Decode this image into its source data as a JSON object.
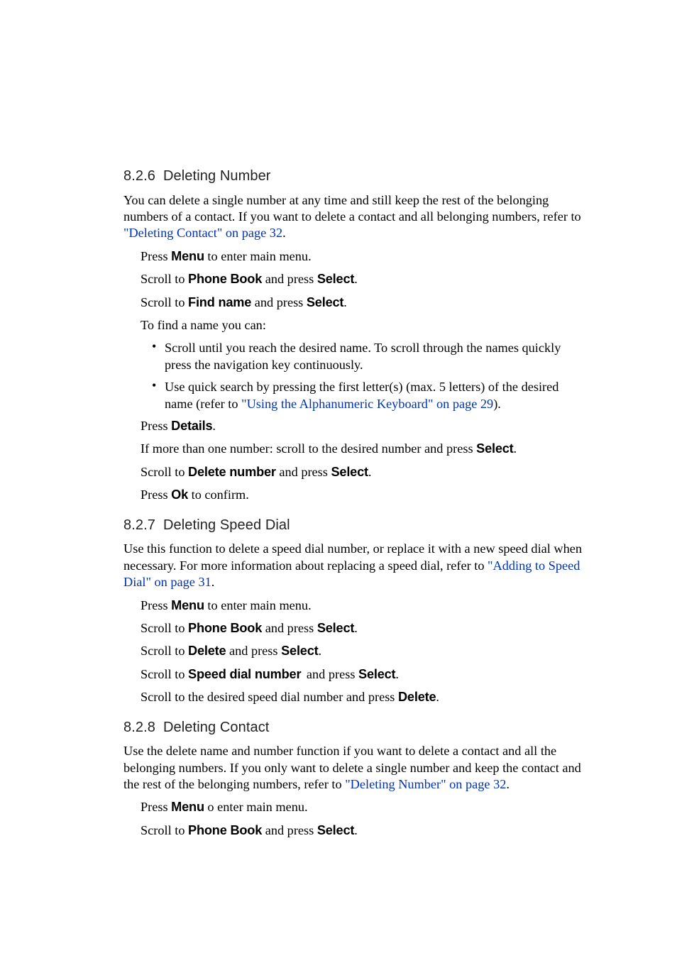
{
  "s826": {
    "num": "8.2.6",
    "title": "Deleting Number",
    "intro_a": "You can delete a single number at any time and still keep the rest of the belonging numbers of a contact. If you want to delete a contact and all belonging numbers, refer to ",
    "intro_link": "\"Deleting Contact\" on page 32",
    "intro_b": ".",
    "press": "Press ",
    "menu": "Menu",
    "enter_main": " to enter main menu.",
    "scrollto": "Scroll to ",
    "phonebook": "Phone Book",
    "andpress": " and press ",
    "select": "Select",
    "period": ".",
    "findname": "Find name",
    "tofind": "To find a name you can:",
    "bul1": "Scroll until you reach the desired name. To scroll through the names quickly press the navigation key continuously.",
    "bul2a": "Use quick search by pressing the first letter(s) (max. 5 letters) of the desired name (refer to ",
    "bul2link": "\"Using the Alphanumeric Keyboard\" on page 29",
    "bul2b": ").",
    "details": "Details",
    "ifmore_a": "If more than one number: scroll to the desired number and press ",
    "deletenumber": "Delete number",
    "ok": "Ok",
    "toconfirm": " to confirm."
  },
  "s827": {
    "num": "8.2.7",
    "title": "Deleting Speed Dial",
    "intro_a": "Use this function to delete a speed dial number, or replace it with a new speed dial when necessary. For more information about replacing a speed dial, refer to ",
    "intro_link": "\"Adding to Speed Dial\" on page 31",
    "intro_b": ".",
    "delete": "Delete",
    "speeddialnumber": "Speed dial number",
    "scrolldesired": "Scroll to the desired speed dial number and press "
  },
  "s828": {
    "num": "8.2.8",
    "title": "Deleting Contact",
    "intro_a": "Use the delete name and number function if you want to delete a contact and all the belonging numbers. If you only want to delete a single number and keep the contact and the rest of the belonging numbers, refer to ",
    "intro_link": "\"Deleting Number\" on page 32",
    "intro_b": ".",
    "oenter": "  o enter main menu."
  }
}
